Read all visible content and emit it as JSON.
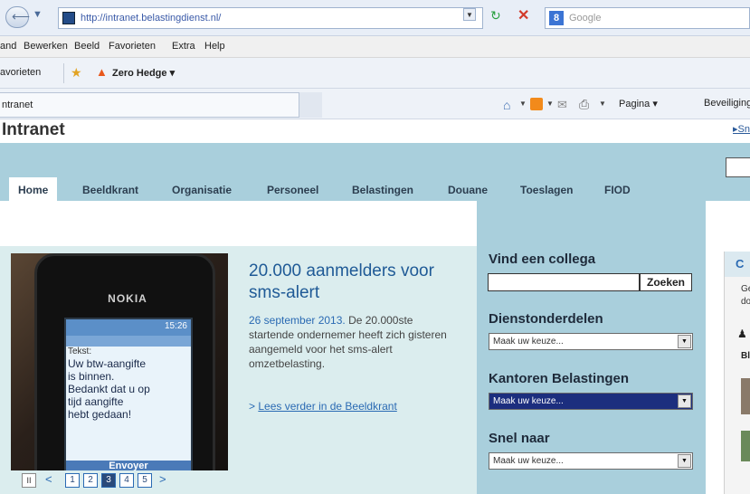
{
  "browser": {
    "url": "http://intranet.belastingdienst.nl/",
    "search_placeholder": "Google",
    "menu": [
      "and",
      "Bewerken",
      "Beeld",
      "Favorieten",
      "Extra",
      "Help"
    ],
    "favorites_label": "avorieten",
    "favorite_link": "Zero Hedge",
    "tab_title": "ntranet",
    "command_page": "Pagina",
    "command_security": "Beveiliging"
  },
  "page": {
    "title": "Intranet",
    "quick_link": "Sn"
  },
  "nav": {
    "tabs": [
      "Home",
      "Beeldkrant",
      "Organisatie",
      "Personeel",
      "Belastingen",
      "Douane",
      "Toeslagen",
      "FIOD"
    ],
    "active": "Home"
  },
  "feature": {
    "phone_brand": "NOKIA",
    "phone_time": "15:26",
    "phone_label": "Tekst:",
    "phone_message": "Uw btw-aangifte\nis binnen.\nBedankt dat u op\ntijd aangifte\nhebt gedaan!",
    "phone_footer": "Envoyer",
    "title": "20.000 aanmelders voor sms-alert",
    "date": "26 september 2013.",
    "text": " De 20.000ste startende ondernemer heeft zich gisteren aangemeld voor het sms-alert omzetbelasting.",
    "link": "Lees verder in de Beeldkrant",
    "link_prefix": ">",
    "slider_pages": [
      "1",
      "2",
      "3",
      "4",
      "5"
    ],
    "slider_current": "3",
    "pause_label": "II",
    "prev": "<",
    "next": ">"
  },
  "sidebar": {
    "find_colleague": "Vind een collega",
    "search_button": "Zoeken",
    "units_heading": "Dienstonderdelen",
    "units_select": "Maak uw keuze...",
    "offices_heading": "Kantoren Belastingen",
    "offices_select": "Maak uw keuze...",
    "quick_heading": "Snel naar",
    "quick_select": "Maak uw keuze..."
  },
  "far_right": {
    "head": "C",
    "line1": "Ge",
    "line2": "do",
    "bold": "Bl"
  }
}
